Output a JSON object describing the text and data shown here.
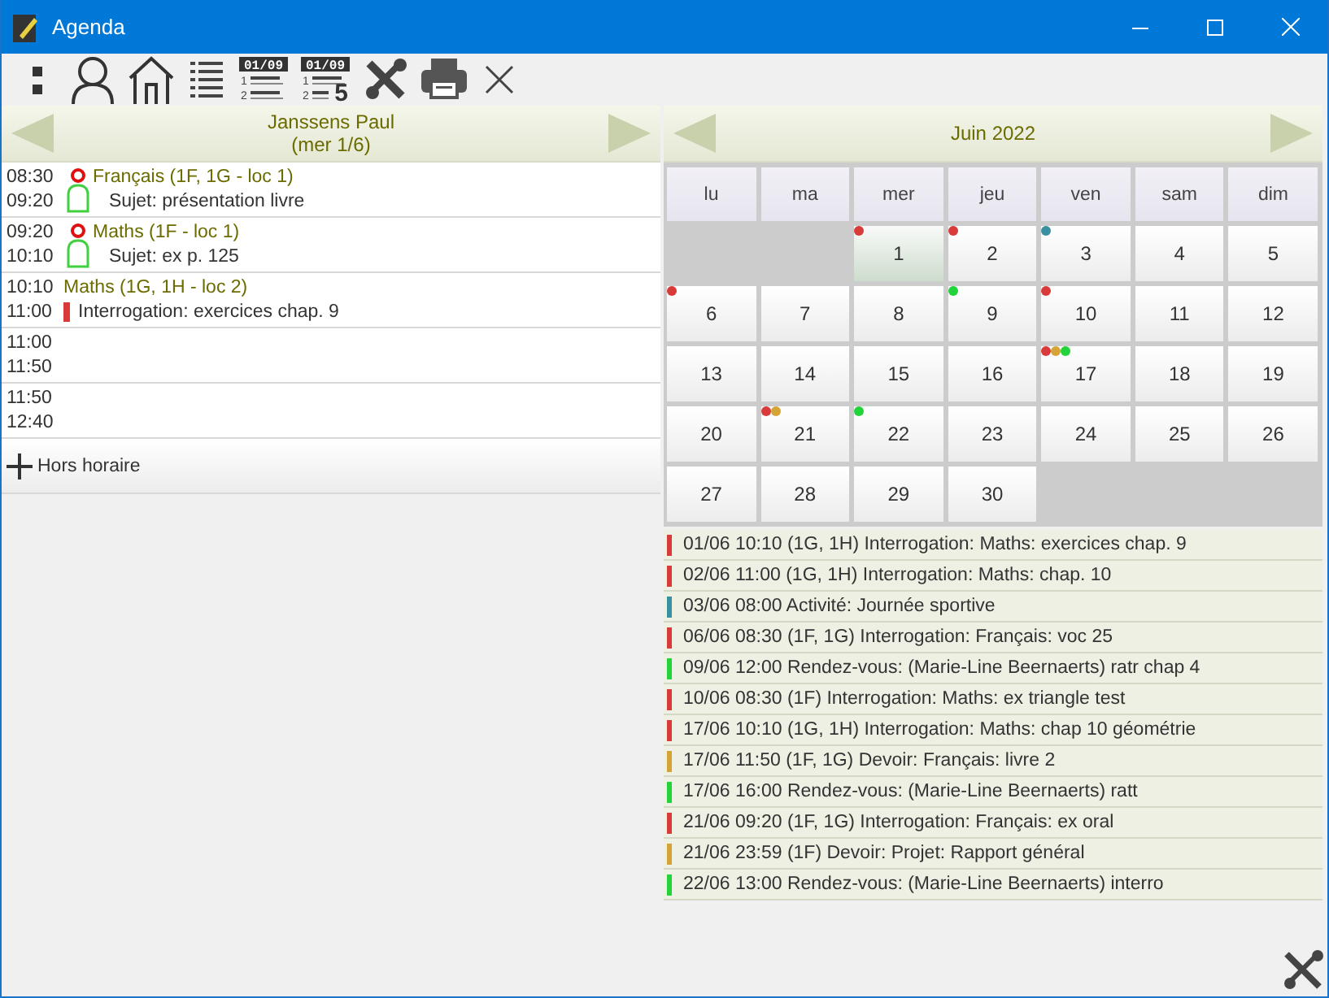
{
  "window": {
    "title": "Agenda"
  },
  "toolbar": [
    {
      "kind": "dots"
    },
    {
      "kind": "person"
    },
    {
      "kind": "home"
    },
    {
      "kind": "list"
    },
    {
      "kind": "datelist",
      "date": "01/09",
      "lines": [
        "1",
        "2"
      ]
    },
    {
      "kind": "datelist",
      "date": "01/09",
      "lines": [
        "1",
        "2"
      ],
      "count": "5"
    },
    {
      "kind": "tools"
    },
    {
      "kind": "print"
    },
    {
      "kind": "close"
    }
  ],
  "day": {
    "name": "Janssens Paul",
    "date": "(mer 1/6)"
  },
  "lessons": [
    {
      "start": "08:30",
      "end": "09:20",
      "kind": "attendance",
      "title": "Français (1F, 1G - loc 1)",
      "detail": "Sujet: présentation livre"
    },
    {
      "start": "09:20",
      "end": "10:10",
      "kind": "attendance",
      "title": "Maths (1F - loc 1)",
      "detail": "Sujet: ex p. 125"
    },
    {
      "start": "10:10",
      "end": "11:00",
      "kind": "test",
      "title": "Maths (1G, 1H - loc 2)",
      "detail": "Interrogation: exercices chap. 9"
    },
    {
      "start": "11:00",
      "end": "11:50",
      "kind": "empty"
    },
    {
      "start": "11:50",
      "end": "12:40",
      "kind": "empty"
    }
  ],
  "extra_button": "Hors horaire",
  "month": {
    "title": "Juin 2022",
    "weekdays": [
      "lu",
      "ma",
      "mer",
      "jeu",
      "ven",
      "sam",
      "dim"
    ],
    "cells": [
      {
        "kind": "blank"
      },
      {
        "kind": "blank"
      },
      {
        "kind": "day",
        "label": "1",
        "selected": true,
        "dots": [
          {
            "color": "#d93a3a"
          }
        ]
      },
      {
        "kind": "day",
        "label": "2",
        "selected": false,
        "dots": [
          {
            "color": "#d93a3a"
          }
        ]
      },
      {
        "kind": "day",
        "label": "3",
        "selected": false,
        "dots": [
          {
            "color": "#3a8fa0"
          }
        ]
      },
      {
        "kind": "day",
        "label": "4",
        "selected": false
      },
      {
        "kind": "day",
        "label": "5",
        "selected": false
      },
      {
        "kind": "day",
        "label": "6",
        "selected": false,
        "dots": [
          {
            "color": "#d93a3a"
          }
        ]
      },
      {
        "kind": "day",
        "label": "7",
        "selected": false
      },
      {
        "kind": "day",
        "label": "8",
        "selected": false
      },
      {
        "kind": "day",
        "label": "9",
        "selected": false,
        "dots": [
          {
            "color": "#22d33a"
          }
        ]
      },
      {
        "kind": "day",
        "label": "10",
        "selected": false,
        "dots": [
          {
            "color": "#d93a3a"
          }
        ]
      },
      {
        "kind": "day",
        "label": "11",
        "selected": false
      },
      {
        "kind": "day",
        "label": "12",
        "selected": false
      },
      {
        "kind": "day",
        "label": "13",
        "selected": false
      },
      {
        "kind": "day",
        "label": "14",
        "selected": false
      },
      {
        "kind": "day",
        "label": "15",
        "selected": false
      },
      {
        "kind": "day",
        "label": "16",
        "selected": false
      },
      {
        "kind": "day",
        "label": "17",
        "selected": false,
        "dots": [
          {
            "color": "#d93a3a"
          },
          {
            "color": "#d4a437"
          },
          {
            "color": "#22d33a"
          }
        ]
      },
      {
        "kind": "day",
        "label": "18",
        "selected": false
      },
      {
        "kind": "day",
        "label": "19",
        "selected": false
      },
      {
        "kind": "day",
        "label": "20",
        "selected": false
      },
      {
        "kind": "day",
        "label": "21",
        "selected": false,
        "dots": [
          {
            "color": "#d93a3a"
          },
          {
            "color": "#d4a437"
          }
        ]
      },
      {
        "kind": "day",
        "label": "22",
        "selected": false,
        "dots": [
          {
            "color": "#22d33a"
          }
        ]
      },
      {
        "kind": "day",
        "label": "23",
        "selected": false
      },
      {
        "kind": "day",
        "label": "24",
        "selected": false
      },
      {
        "kind": "day",
        "label": "25",
        "selected": false
      },
      {
        "kind": "day",
        "label": "26",
        "selected": false
      },
      {
        "kind": "day",
        "label": "27",
        "selected": false
      },
      {
        "kind": "day",
        "label": "28",
        "selected": false
      },
      {
        "kind": "day",
        "label": "29",
        "selected": false
      },
      {
        "kind": "day",
        "label": "30",
        "selected": false
      },
      {
        "kind": "blank"
      },
      {
        "kind": "blank"
      },
      {
        "kind": "blank"
      }
    ]
  },
  "events": [
    {
      "text": "01/06 10:10 (1G, 1H) Interrogation: Maths: exercices chap. 9",
      "color": "#d93a3a"
    },
    {
      "text": "02/06 11:00 (1G, 1H) Interrogation: Maths: chap. 10",
      "color": "#d93a3a"
    },
    {
      "text": "03/06 08:00 Activité: Journée sportive",
      "color": "#3a8fa0"
    },
    {
      "text": "06/06 08:30 (1F, 1G) Interrogation: Français: voc 25",
      "color": "#d93a3a"
    },
    {
      "text": "09/06 12:00 Rendez-vous: (Marie-Line Beernaerts) ratr chap 4",
      "color": "#22d33a"
    },
    {
      "text": "10/06 08:30 (1F) Interrogation: Maths: ex triangle test",
      "color": "#d93a3a"
    },
    {
      "text": "17/06 10:10 (1G, 1H) Interrogation: Maths: chap 10 géométrie",
      "color": "#d93a3a"
    },
    {
      "text": "17/06 11:50 (1F, 1G) Devoir: Français: livre 2",
      "color": "#d4a437"
    },
    {
      "text": "17/06 16:00 Rendez-vous: (Marie-Line Beernaerts) ratt",
      "color": "#22d33a"
    },
    {
      "text": "21/06 09:20 (1F, 1G) Interrogation: Français: ex oral",
      "color": "#d93a3a"
    },
    {
      "text": "21/06 23:59 (1F) Devoir: Projet: Rapport général",
      "color": "#d4a437"
    },
    {
      "text": "22/06 13:00 Rendez-vous: (Marie-Line Beernaerts) interro",
      "color": "#22d33a"
    }
  ]
}
